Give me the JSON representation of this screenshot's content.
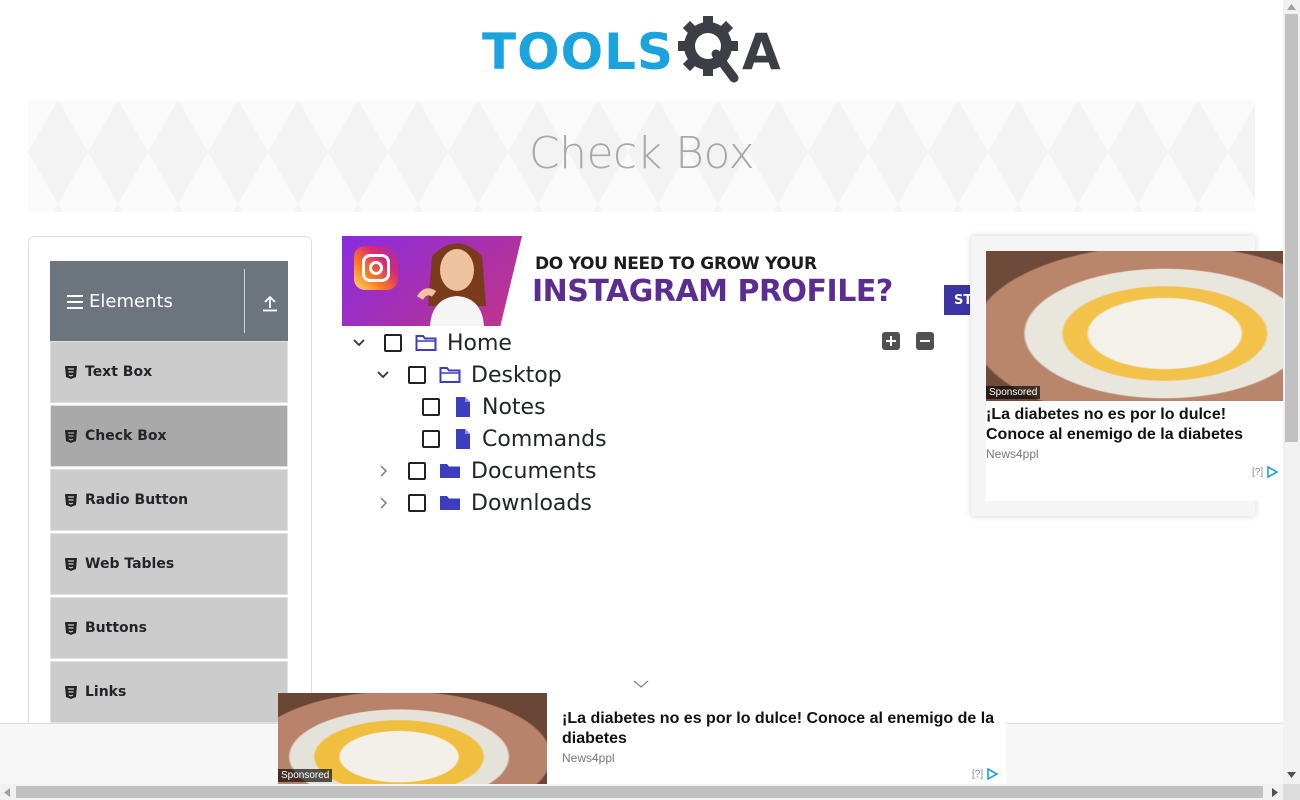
{
  "logo": {
    "part1": "TOOLS",
    "part2": "A"
  },
  "banner": {
    "title": "Check Box"
  },
  "sidebar": {
    "group_label": "Elements",
    "items": [
      {
        "label": "Text Box"
      },
      {
        "label": "Check Box"
      },
      {
        "label": "Radio Button"
      },
      {
        "label": "Web Tables"
      },
      {
        "label": "Buttons"
      },
      {
        "label": "Links"
      }
    ]
  },
  "top_ad": {
    "line1": "DO YOU NEED TO GROW YOUR",
    "line2": "INSTAGRAM PROFILE?",
    "button": "ST"
  },
  "tree": {
    "home": "Home",
    "desktop": "Desktop",
    "notes": "Notes",
    "commands": "Commands",
    "documents": "Documents",
    "downloads": "Downloads"
  },
  "right_ad": {
    "sponsored": "Sponsored",
    "headline_line1": "¡La diabetes no es por lo dulce!",
    "headline_line2": "Conoce al enemigo de la diabetes",
    "source": "News4ppl",
    "adchoice": "[?]"
  },
  "bottom_ad": {
    "sponsored": "Sponsored",
    "headline_line1": "¡La diabetes no es por lo dulce! Conoce al enemigo de la",
    "headline_line2": "diabetes",
    "source": "News4ppl",
    "adchoice": "[?]"
  },
  "colors": {
    "logo_blue": "#1aa3dc",
    "logo_dark": "#3b3f45",
    "group_header": "#6c757d",
    "menu_item": "#cccccc",
    "menu_item_active": "#a9a9a9",
    "folder_icon": "#3d3dbf"
  }
}
